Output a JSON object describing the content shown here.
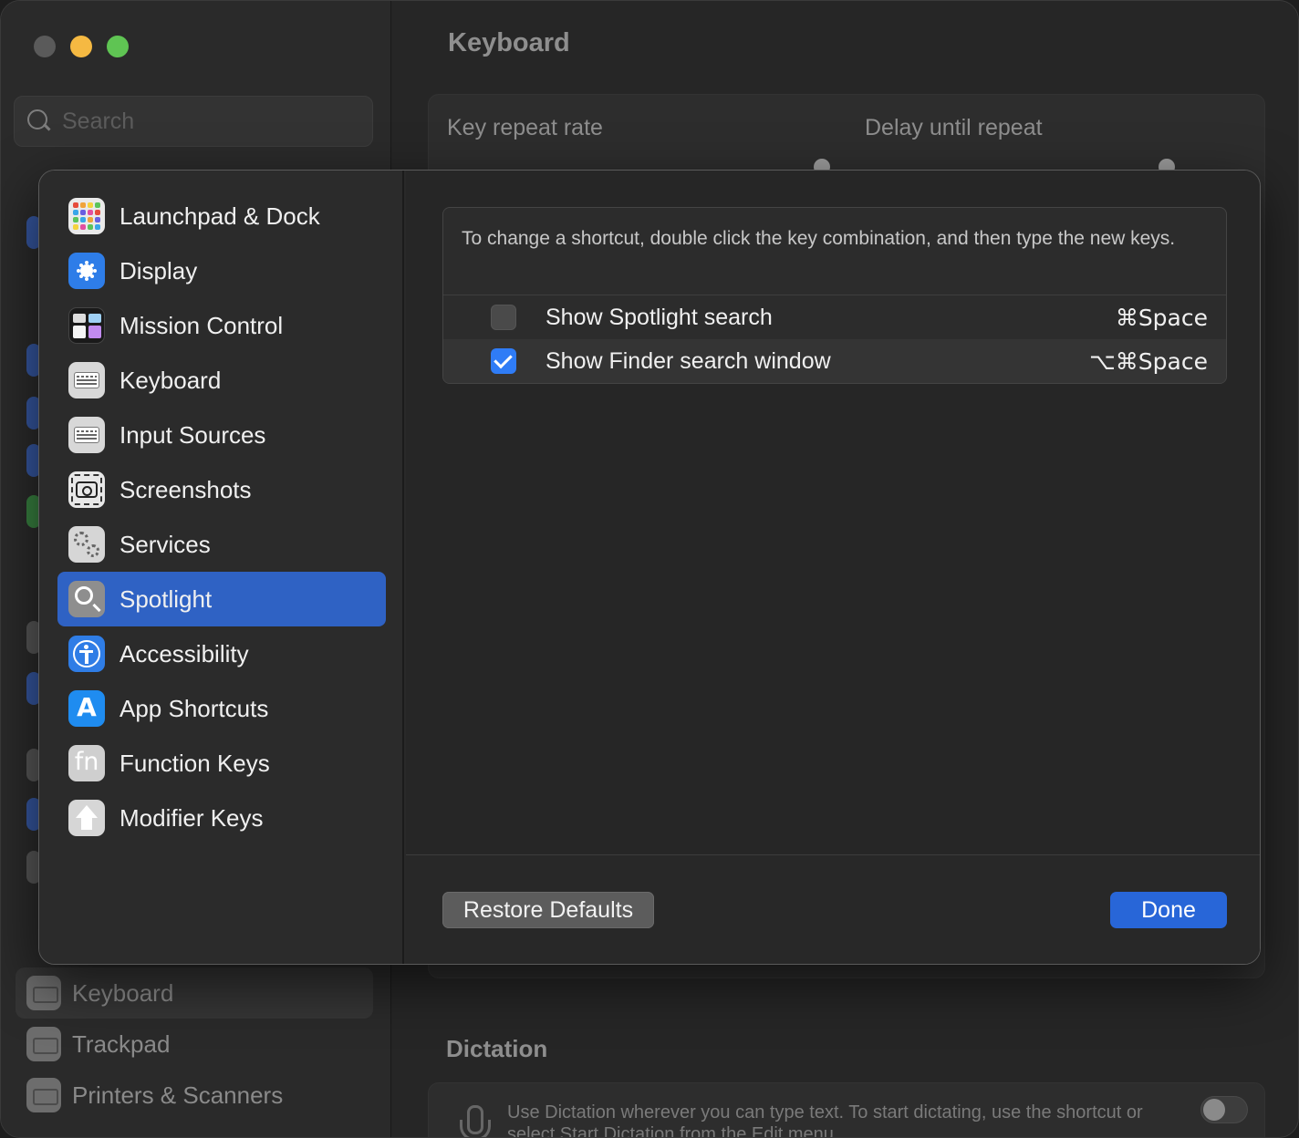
{
  "background": {
    "search": {
      "placeholder": "Search"
    },
    "title": "Keyboard",
    "key_repeat_label": "Key repeat rate",
    "delay_label": "Delay until repeat",
    "dictation_title": "Dictation",
    "dictation_text": "Use Dictation wherever you can type text. To start dictating, use the shortcut or select Start Dictation from the Edit menu.",
    "sidebar_bottom": [
      {
        "label": "Keyboard",
        "icon": "keyboard-icon",
        "selected": true
      },
      {
        "label": "Trackpad",
        "icon": "trackpad-icon",
        "selected": false
      },
      {
        "label": "Printers & Scanners",
        "icon": "printer-icon",
        "selected": false
      }
    ]
  },
  "sheet": {
    "categories": [
      {
        "label": "Launchpad & Dock",
        "icon": "launchpad-icon"
      },
      {
        "label": "Display",
        "icon": "display-icon"
      },
      {
        "label": "Mission Control",
        "icon": "mission-control-icon"
      },
      {
        "label": "Keyboard",
        "icon": "keyboard-icon"
      },
      {
        "label": "Input Sources",
        "icon": "keyboard-icon"
      },
      {
        "label": "Screenshots",
        "icon": "screenshot-icon"
      },
      {
        "label": "Services",
        "icon": "gears-icon"
      },
      {
        "label": "Spotlight",
        "icon": "spotlight-icon",
        "selected": true
      },
      {
        "label": "Accessibility",
        "icon": "accessibility-icon"
      },
      {
        "label": "App Shortcuts",
        "icon": "app-store-icon"
      },
      {
        "label": "Function Keys",
        "icon": "fn-icon"
      },
      {
        "label": "Modifier Keys",
        "icon": "modifier-arrow-icon"
      }
    ],
    "hint": "To change a shortcut, double click the key combination, and then type the new keys.",
    "shortcuts": [
      {
        "name": "Show Spotlight search",
        "keys": "⌘Space",
        "checked": false
      },
      {
        "name": "Show Finder search window",
        "keys": "⌥⌘Space",
        "checked": true
      }
    ],
    "restore_label": "Restore Defaults",
    "done_label": "Done"
  },
  "colors": {
    "accent": "#2f62c4",
    "done_button": "#2866d8",
    "checkbox_on": "#2f7cf6"
  }
}
